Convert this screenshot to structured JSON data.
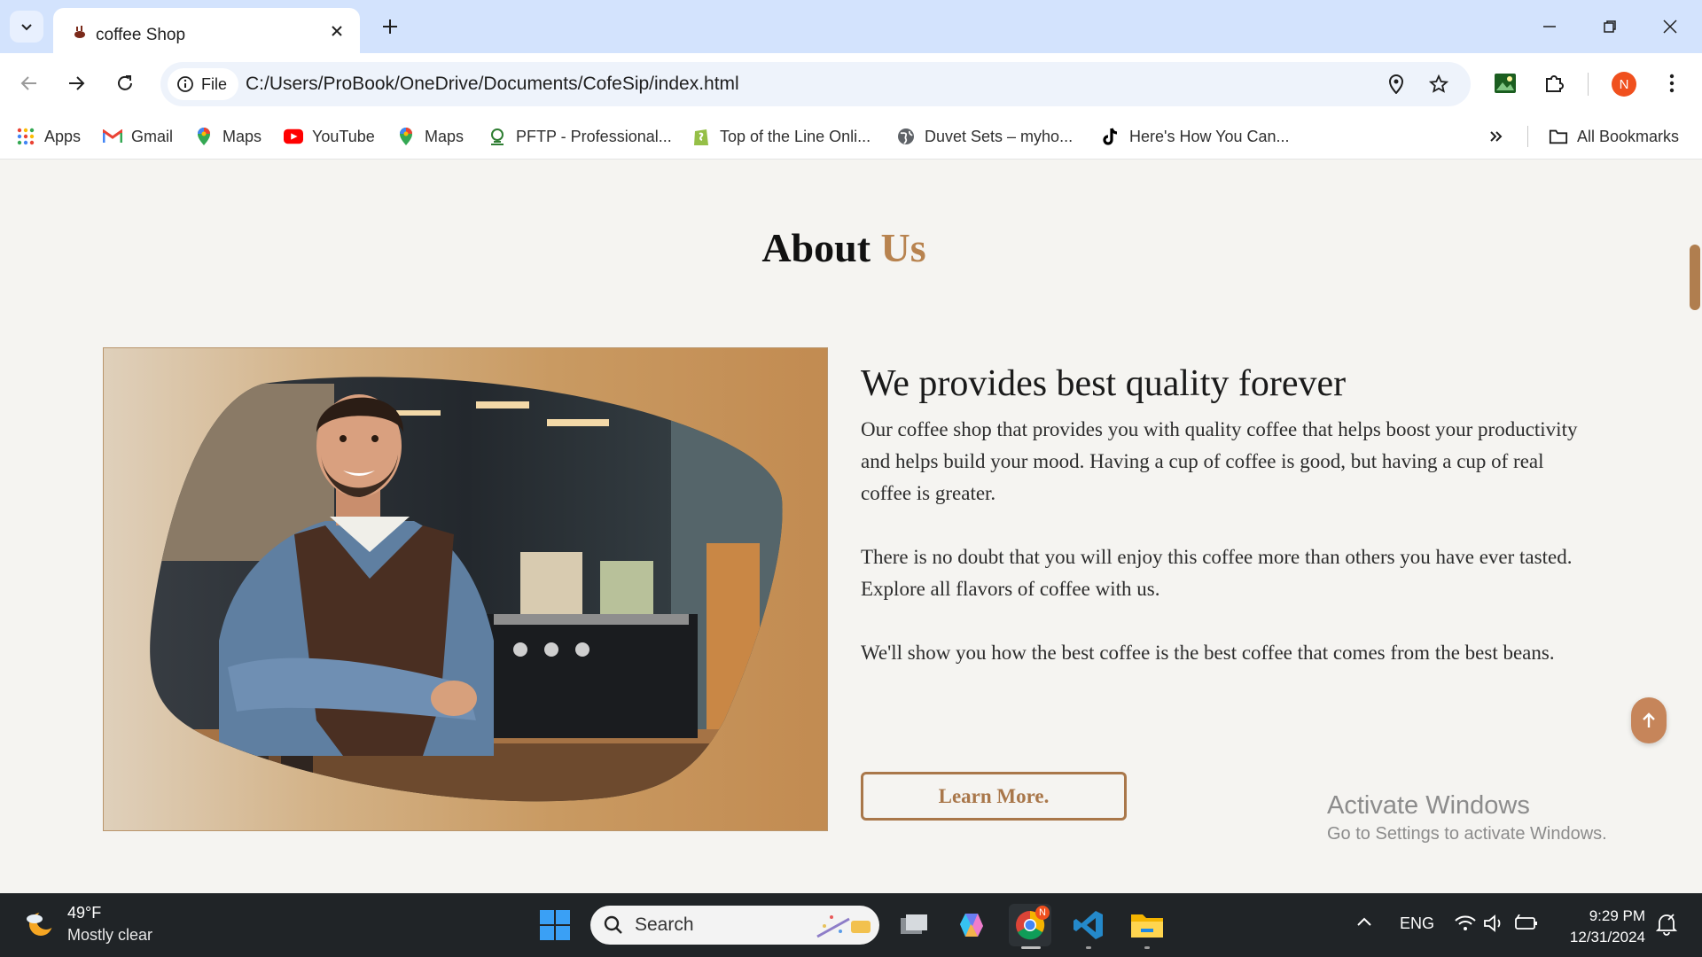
{
  "browser": {
    "tab_title": "coffee Shop",
    "url_scheme_label": "File",
    "url": "C:/Users/ProBook/OneDrive/Documents/CofeSip/index.html",
    "profile_initial": "N"
  },
  "bookmarks": {
    "items": [
      {
        "label": "Apps",
        "icon": "apps-grid-icon"
      },
      {
        "label": "Gmail",
        "icon": "gmail-icon"
      },
      {
        "label": "Maps",
        "icon": "maps-pin-icon"
      },
      {
        "label": "YouTube",
        "icon": "youtube-icon"
      },
      {
        "label": "Maps",
        "icon": "maps-pin-icon"
      },
      {
        "label": "PFTP - Professional...",
        "icon": "pftp-icon"
      },
      {
        "label": "Top of the Line Onli...",
        "icon": "shopify-icon"
      },
      {
        "label": "Duvet Sets – myho...",
        "icon": "globe-icon"
      },
      {
        "label": "Here's How You Can...",
        "icon": "tiktok-icon"
      }
    ],
    "all_bookmarks": "All Bookmarks"
  },
  "page": {
    "heading_main": "About",
    "heading_accent": "Us",
    "subheading": "We provides best quality forever",
    "paragraphs": [
      "Our coffee shop that provides you with quality coffee that helps boost your productivity and helps build your mood. Having a cup of coffee is good, but having a cup of real coffee is greater.",
      "There is no doubt that you will enjoy this coffee more than others you have ever tasted. Explore all flavors of coffee with us.",
      "We'll show you how the best coffee is the best coffee that comes from the best beans."
    ],
    "learn_more": "Learn More."
  },
  "watermark": {
    "title": "Activate Windows",
    "subtitle": "Go to Settings to activate Windows."
  },
  "taskbar": {
    "temperature": "49°F",
    "condition": "Mostly clear",
    "search_placeholder": "Search",
    "language": "ENG",
    "time": "9:29 PM",
    "date": "12/31/2024",
    "chrome_badge": "N"
  },
  "colors": {
    "accent": "#b8834f",
    "button_border": "#a9774a",
    "taskbar": "#202427"
  }
}
